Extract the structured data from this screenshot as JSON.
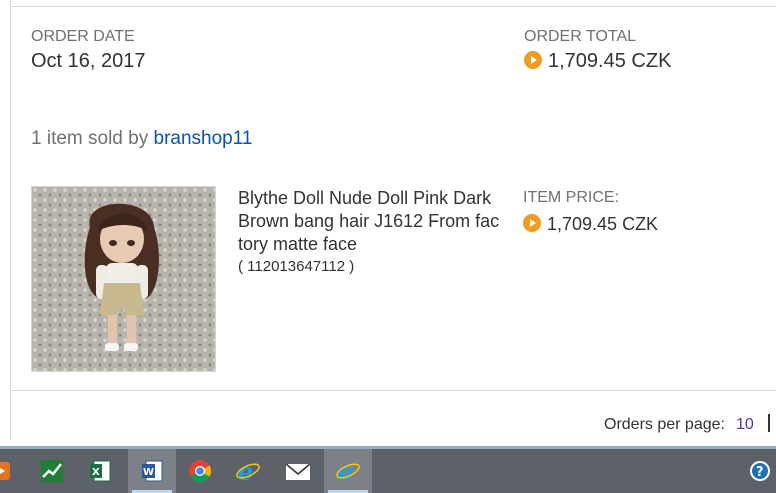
{
  "order": {
    "date_label": "ORDER DATE",
    "date_value": "Oct 16, 2017",
    "total_label": "ORDER TOTAL",
    "total_value": "1,709.45 CZK"
  },
  "seller": {
    "prefix": "1 item sold by",
    "name": "branshop11"
  },
  "item": {
    "title": "Blythe Doll Nude Doll Pink Dark Brown bang hair J1612 From factory matte face",
    "id": "( 112013647112 )",
    "price_label": "ITEM PRICE:",
    "price_value": "1,709.45 CZK"
  },
  "pagination": {
    "label": "Orders per page:",
    "value": "10"
  },
  "taskbar": {
    "apps": [
      "media-player-icon",
      "stock-chart-icon",
      "excel-icon",
      "word-icon",
      "chrome-icon",
      "internet-explorer-icon",
      "mail-icon",
      "internet-explorer-active-icon",
      "help-icon"
    ]
  },
  "colors": {
    "link": "#0654ba",
    "coin": "#f29b1f",
    "taskbar": "#5c6268"
  }
}
